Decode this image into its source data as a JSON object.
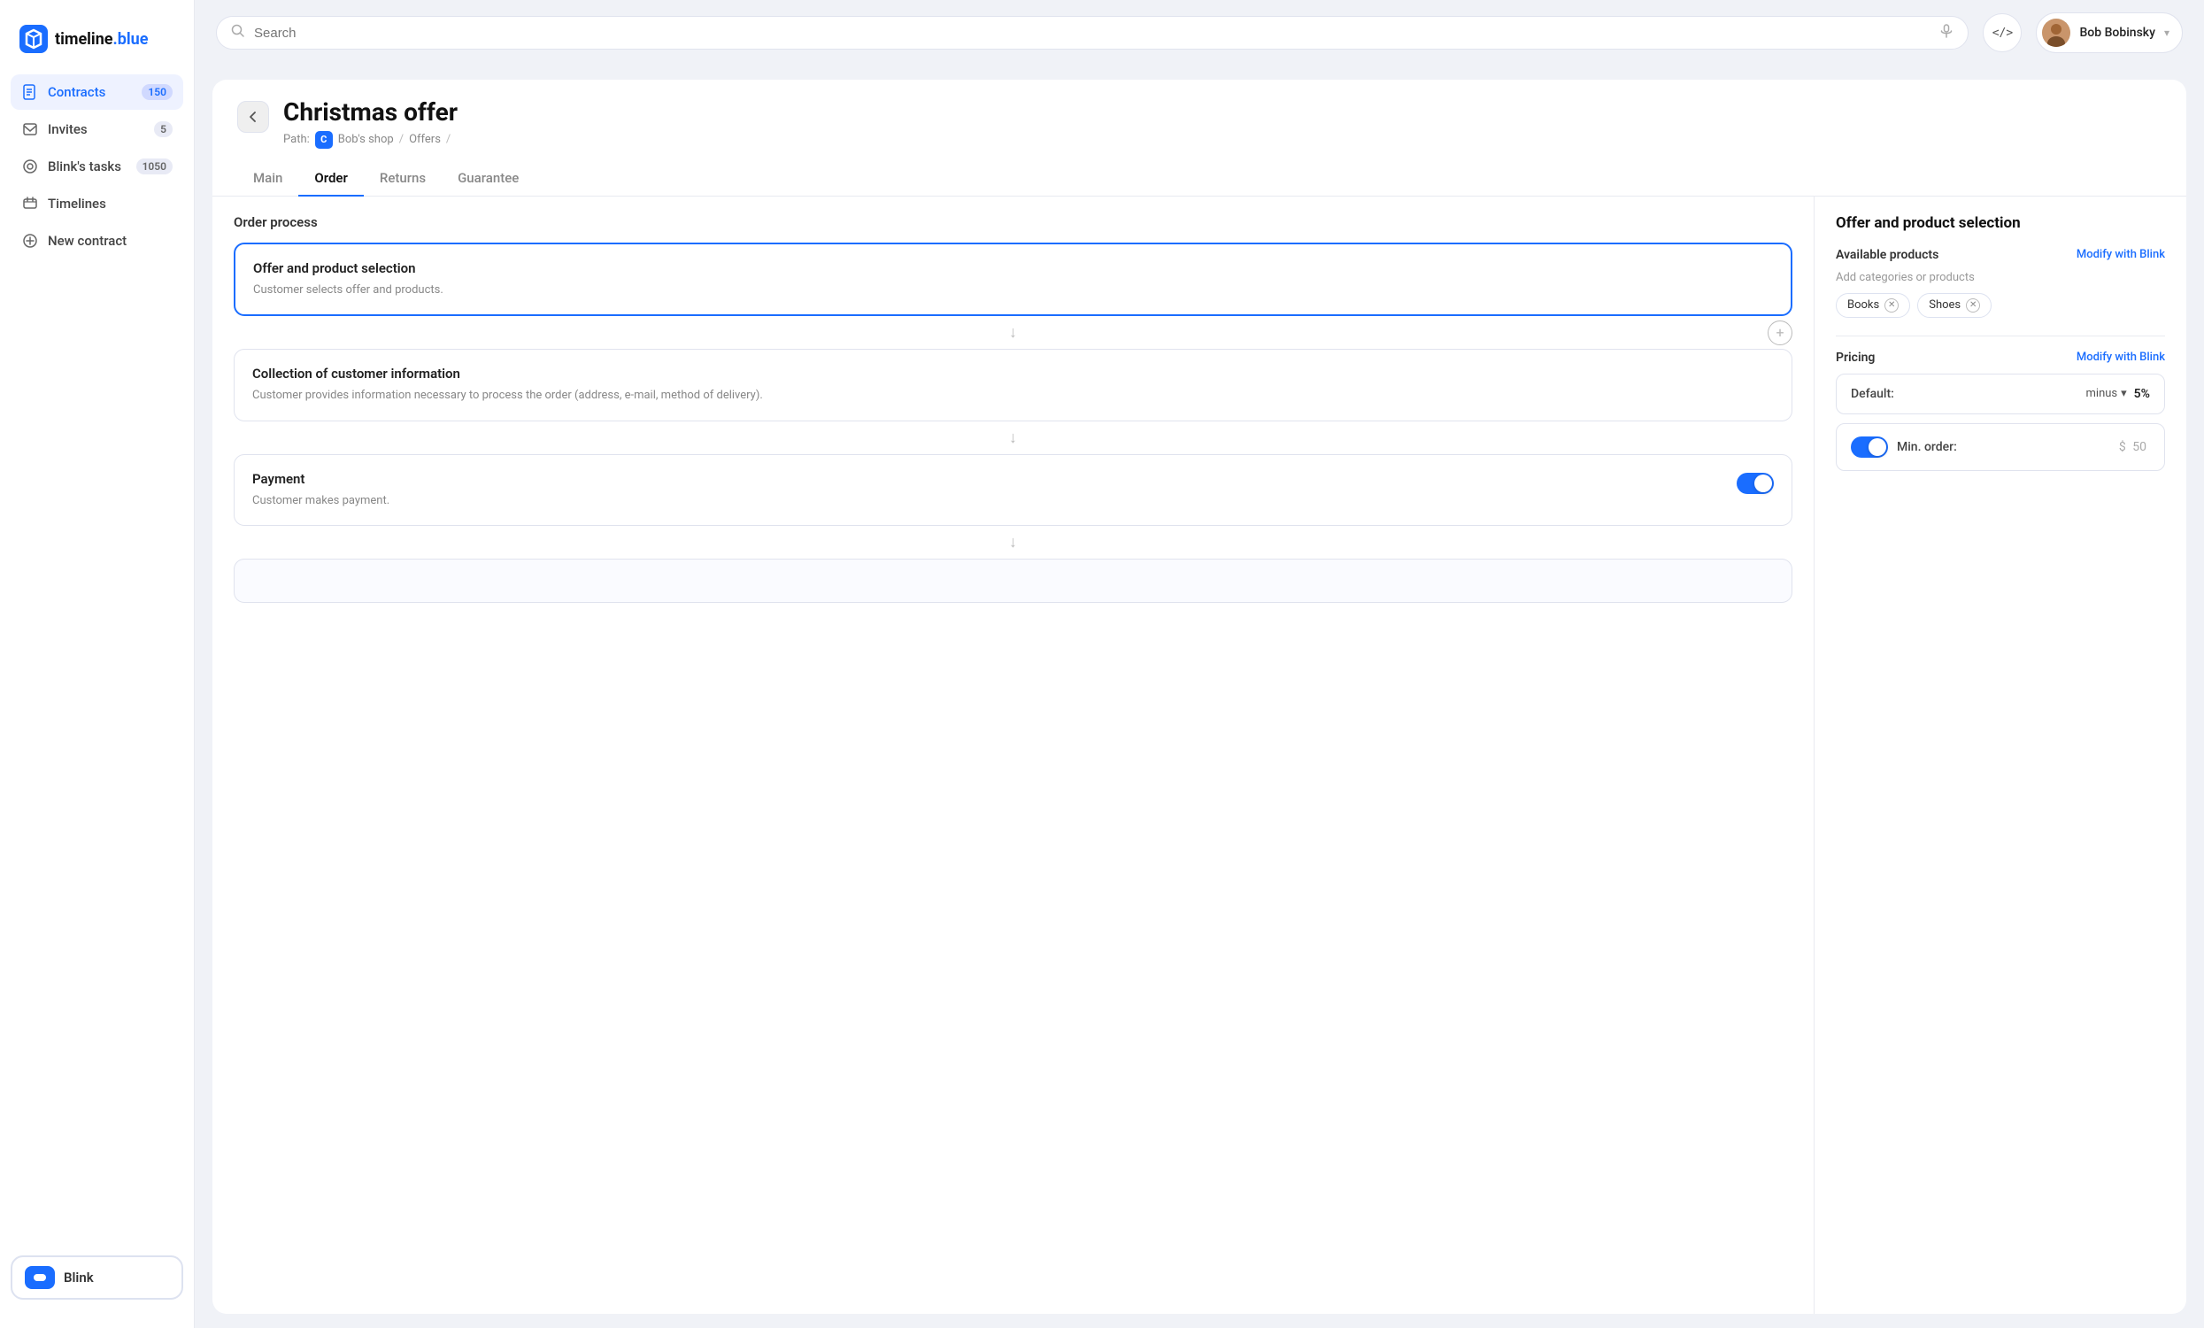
{
  "app": {
    "name": "timeline",
    "nameSuffix": ".blue"
  },
  "sidebar": {
    "nav": [
      {
        "id": "contracts",
        "label": "Contracts",
        "badge": "150",
        "active": true
      },
      {
        "id": "invites",
        "label": "Invites",
        "badge": "5",
        "active": false
      },
      {
        "id": "blinks-tasks",
        "label": "Blink's tasks",
        "badge": "1050",
        "active": false
      },
      {
        "id": "timelines",
        "label": "Timelines",
        "badge": "",
        "active": false
      },
      {
        "id": "new-contract",
        "label": "New contract",
        "badge": "",
        "active": false
      }
    ],
    "blink_label": "Blink"
  },
  "header": {
    "search_placeholder": "Search",
    "user_name": "Bob Bobinsky",
    "code_icon": "</>",
    "mic_icon": "🎤"
  },
  "page": {
    "title": "Christmas offer",
    "back_arrow": "←",
    "breadcrumb": {
      "prefix": "Path:",
      "initial": "C",
      "shop": "Bob's shop",
      "sep1": "/",
      "section": "Offers",
      "sep2": "/"
    },
    "tabs": [
      {
        "id": "main",
        "label": "Main",
        "active": false
      },
      {
        "id": "order",
        "label": "Order",
        "active": true
      },
      {
        "id": "returns",
        "label": "Returns",
        "active": false
      },
      {
        "id": "guarantee",
        "label": "Guarantee",
        "active": false
      }
    ]
  },
  "order_process": {
    "title": "Order process",
    "steps": [
      {
        "id": "offer-selection",
        "title": "Offer and product selection",
        "description": "Customer selects offer and products.",
        "selected": true,
        "has_toggle": false
      },
      {
        "id": "customer-info",
        "title": "Collection of customer information",
        "description": "Customer provides information necessary to process the order (address, e-mail, method of delivery).",
        "selected": false,
        "has_toggle": false
      },
      {
        "id": "payment",
        "title": "Payment",
        "description": "Customer makes payment.",
        "selected": false,
        "has_toggle": true,
        "toggle_on": true
      }
    ]
  },
  "right_panel": {
    "title": "Offer and product selection",
    "available_products": {
      "label": "Available products",
      "modify_link": "Modify with Blink",
      "add_label": "Add categories or products",
      "tags": [
        {
          "label": "Books"
        },
        {
          "label": "Shoes"
        }
      ]
    },
    "pricing": {
      "label": "Pricing",
      "modify_link": "Modify with Blink",
      "default_label": "Default:",
      "default_operator": "minus",
      "default_value": "5%",
      "min_order_label": "Min. order:",
      "min_order_currency": "$",
      "min_order_value": "50",
      "min_order_toggle_on": true
    }
  }
}
